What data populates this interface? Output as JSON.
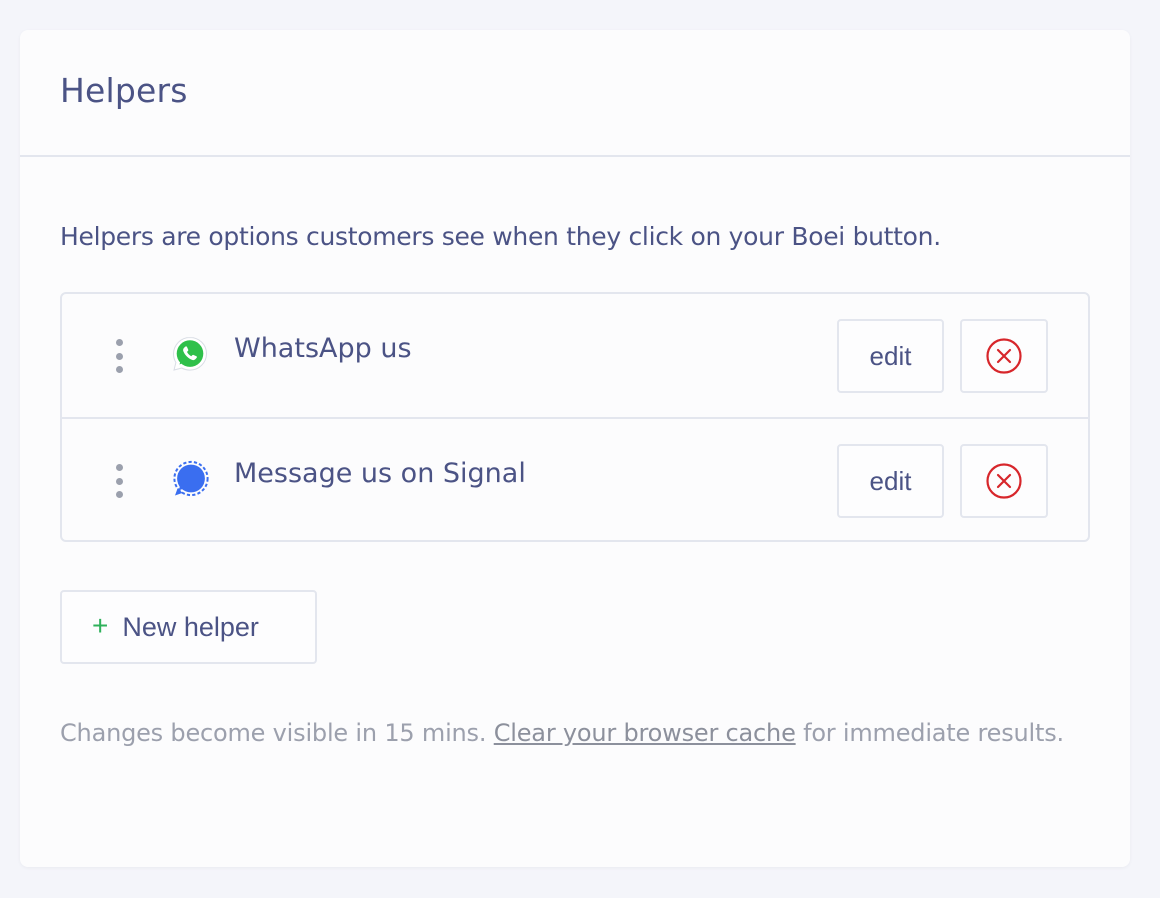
{
  "card": {
    "title": "Helpers",
    "intro": "Helpers are options customers see when they click on your Boei button."
  },
  "helpers": [
    {
      "label": "WhatsApp us",
      "icon": "whatsapp-icon",
      "icon_color": "#2fc04a",
      "edit_label": "edit"
    },
    {
      "label": "Message us on Signal",
      "icon": "signal-icon",
      "icon_color": "#3a6ef0",
      "edit_label": "edit"
    }
  ],
  "new_helper": {
    "icon": "+",
    "label": "New helper"
  },
  "footer": {
    "text_before": "Changes become visible in 15 mins. ",
    "link": "Clear your browser cache",
    "text_after": " for immediate results."
  },
  "colors": {
    "text": "#4b5385",
    "muted": "#9ca0ad",
    "remove": "#d7262b",
    "add": "#2fb15b",
    "border": "#e3e6ee"
  }
}
